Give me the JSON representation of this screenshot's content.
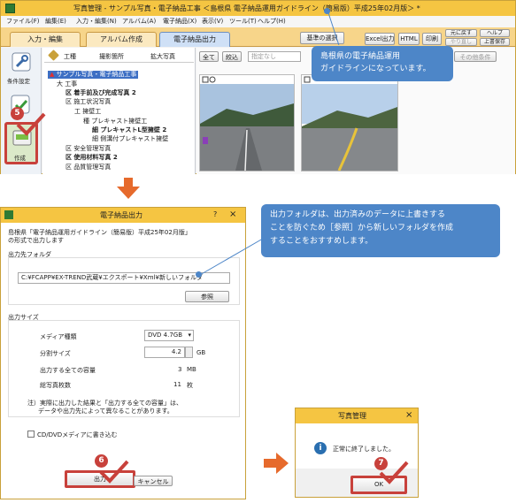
{
  "main": {
    "title": "写真管理 - サンプル写真・電子納品工事 ＜島根県 電子納品運用ガイドライン（簡易版）平成25年02月版＞ *",
    "menu": [
      "ファイル(F)",
      "編集(E)",
      "入力・編集(N)",
      "アルバム(A)",
      "電子納品(X)",
      "表示(V)",
      "ツール(T)",
      "ヘルプ(H)"
    ],
    "tabs": [
      "入力・編集",
      "アルバム作成",
      "電子納品出力"
    ],
    "tool_buttons": [
      "基準の選択",
      "Excel出力",
      "HTML",
      "印刷",
      "元に戻す",
      "ヘルプ",
      "やり直し",
      "上書保存"
    ],
    "side_icons": [
      "条件設定",
      "作成"
    ],
    "panel_tabs": [
      "工種",
      "撮影箇所",
      "拡大写真"
    ],
    "filter": {
      "all": "全て",
      "narrow": "絞込",
      "unspecified": "指定なし",
      "other": "その他条件"
    },
    "tree": [
      "サンプル写真・電子納品工事",
      "大 工事",
      "区 着手前及び完成写真 2",
      "区 施工状況写真",
      "工 擁壁工",
      "種 プレキャスト擁壁工",
      "細 プレキャストL型擁壁 2",
      "細 側溝付プレキャスト擁壁",
      "区 安全管理写真",
      "区 使用材料写真 2",
      "区 品質管理写真"
    ]
  },
  "dialog": {
    "title": "電子納品出力",
    "help": "?",
    "close": "×",
    "description": [
      "島根県「電子納品運用ガイドライン（簡易版）平成25年02月版」",
      "の形式で出力します"
    ],
    "output_folder_label": "出力先フォルダ",
    "output_folder_value": "C:¥FCAPP¥EX-TREND武蔵¥エクスポート¥Xml¥新しいフォルダ",
    "browse": "参照",
    "output_size_label": "出力サイズ",
    "media_label": "メディア種類",
    "media_value": "DVD 4.7GB",
    "split_label": "分割サイズ",
    "split_value": "4.2",
    "split_unit": "GB",
    "total_label": "出力する全ての容量",
    "total_value": "3",
    "total_unit": "MB",
    "photo_label": "総写真枚数",
    "photo_value": "11",
    "photo_unit": "枚",
    "note": [
      "注）実際に出力した結果と「出力する全ての容量」は、",
      "データや出力先によって異なることがあります。"
    ],
    "cd_checkbox": "CD/DVDメディアに書き込む",
    "output_button": "出力",
    "cancel_button": "キャンセル"
  },
  "message": {
    "title": "写真管理",
    "close": "×",
    "text": "正常に終了しました。",
    "ok": "OK"
  },
  "callouts": {
    "guideline": [
      "島根県の電子納品運用",
      "ガイドラインになっています。"
    ],
    "folder": [
      "出力フォルダは、出力済みのデータに上書きする",
      "ことを防ぐため［参照］から新しいフォルダを作成",
      "することをおすすめします。"
    ]
  },
  "steps": [
    "5",
    "6",
    "7"
  ],
  "colors": {
    "accent": "#4d86c8",
    "step": "#c8413b",
    "arrow": "#e66a2c",
    "frame": "#f5c542"
  }
}
